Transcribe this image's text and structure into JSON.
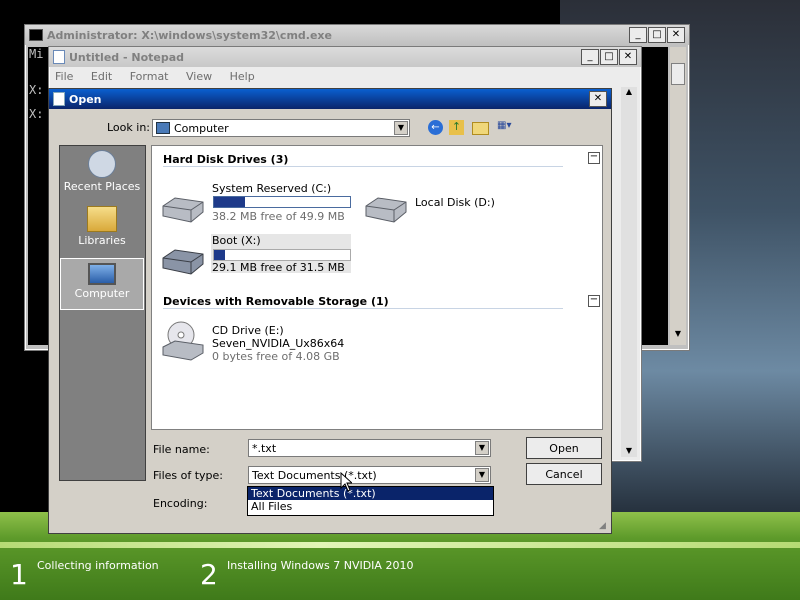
{
  "cmd": {
    "title": "Administrator: X:\\windows\\system32\\cmd.exe",
    "line1": "Mi",
    "line2": "X:",
    "line3": "X:"
  },
  "notepad": {
    "title": "Untitled - Notepad",
    "menu": [
      "File",
      "Edit",
      "Format",
      "View",
      "Help"
    ]
  },
  "open_dialog": {
    "title": "Open",
    "look_in_label": "Look in:",
    "look_in_value": "Computer",
    "places": [
      {
        "label": "Recent Places",
        "icon": "recent-places-icon"
      },
      {
        "label": "Libraries",
        "icon": "libraries-icon"
      },
      {
        "label": "Computer",
        "icon": "computer-icon"
      }
    ],
    "groups": [
      {
        "title": "Hard Disk Drives (3)"
      },
      {
        "title": "Devices with Removable Storage (1)"
      }
    ],
    "drives": {
      "system_reserved": {
        "name": "System Reserved (C:)",
        "free": "38.2 MB free of 49.9 MB",
        "used_fraction": 0.23
      },
      "local_disk": {
        "name": "Local Disk (D:)"
      },
      "boot": {
        "name": "Boot (X:)",
        "free": "29.1 MB free of 31.5 MB",
        "used_fraction": 0.08
      },
      "cd": {
        "name": "CD Drive (E:)",
        "label": "Seven_NVIDIA_Ux86x64",
        "free": "0 bytes free of 4.08 GB"
      }
    },
    "file_name_label": "File name:",
    "file_name_value": "*.txt",
    "files_of_type_label": "Files of type:",
    "files_of_type_value": "Text Documents (*.txt)",
    "encoding_label": "Encoding:",
    "open_button": "Open",
    "cancel_button": "Cancel",
    "dropdown_options": [
      "Text Documents (*.txt)",
      "All Files"
    ]
  },
  "setup": {
    "steps": [
      {
        "num": "1",
        "label": "Collecting information"
      },
      {
        "num": "2",
        "label": "Installing Windows 7 NVIDIA 2010"
      }
    ]
  },
  "colors": {
    "title_active": "#0a246a",
    "setup_green": "#5d9a2a"
  }
}
